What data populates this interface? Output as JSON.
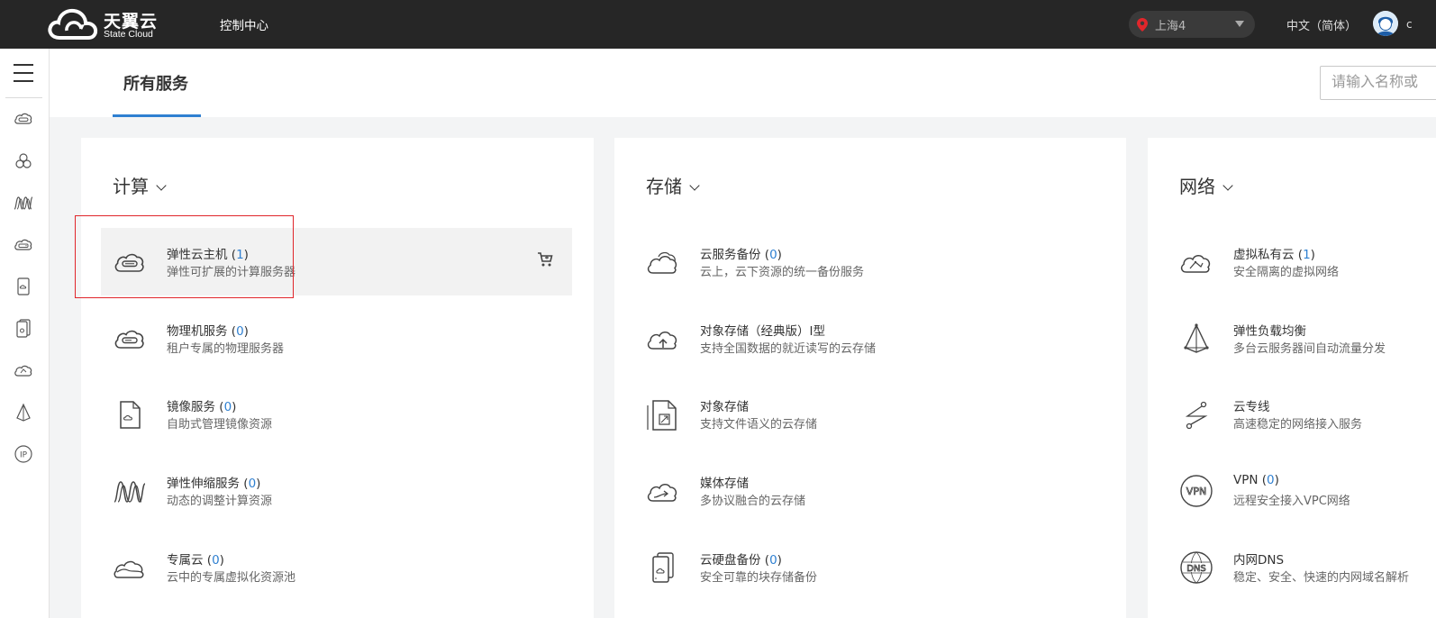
{
  "header": {
    "brand_cn": "天翼云",
    "brand_en": "State Cloud",
    "console_label": "控制中心",
    "region": "上海4",
    "language": "中文（简体）",
    "user_initial": "c"
  },
  "tabs": {
    "all_services": "所有服务"
  },
  "search": {
    "placeholder": "请输入名称或"
  },
  "sidebar": {
    "icons": [
      "ecs-icon",
      "cluster-icon",
      "autoscale-icon",
      "bms-icon",
      "image-icon",
      "backup-icon",
      "vpc-icon",
      "elb-icon",
      "eip-icon"
    ]
  },
  "categories": [
    {
      "title": "计算",
      "items": [
        {
          "name": "弹性云主机",
          "count": "1",
          "desc": "弹性可扩展的计算服务器",
          "icon": "ecs-icon"
        },
        {
          "name": "物理机服务",
          "count": "0",
          "desc": "租户专属的物理服务器",
          "icon": "bms-icon"
        },
        {
          "name": "镜像服务",
          "count": "0",
          "desc": "自助式管理镜像资源",
          "icon": "image-icon"
        },
        {
          "name": "弹性伸缩服务",
          "count": "0",
          "desc": "动态的调整计算资源",
          "icon": "autoscale-icon"
        },
        {
          "name": "专属云",
          "count": "0",
          "desc": "云中的专属虚拟化资源池",
          "icon": "dedicated-cloud-icon"
        }
      ]
    },
    {
      "title": "存储",
      "items": [
        {
          "name": "云服务备份",
          "count": "0",
          "desc": "云上，云下资源的统一备份服务",
          "icon": "cloud-backup-icon"
        },
        {
          "name": "对象存储（经典版）Ⅰ型",
          "count": "",
          "desc": "支持全国数据的就近读写的云存储",
          "icon": "cloud-upload-icon"
        },
        {
          "name": "对象存储",
          "count": "",
          "desc": "支持文件语义的云存储",
          "icon": "file-storage-icon"
        },
        {
          "name": "媒体存储",
          "count": "",
          "desc": "多协议融合的云存储",
          "icon": "media-storage-icon"
        },
        {
          "name": "云硬盘备份",
          "count": "0",
          "desc": "安全可靠的块存储备份",
          "icon": "disk-backup-icon"
        }
      ]
    },
    {
      "title": "网络",
      "items": [
        {
          "name": "虚拟私有云",
          "count": "1",
          "desc": "安全隔离的虚拟网络",
          "icon": "vpc-icon"
        },
        {
          "name": "弹性负载均衡",
          "count": "",
          "desc": "多台云服务器间自动流量分发",
          "icon": "elb-icon"
        },
        {
          "name": "云专线",
          "count": "",
          "desc": "高速稳定的网络接入服务",
          "icon": "direct-connect-icon"
        },
        {
          "name": "VPN",
          "count": "0",
          "desc": "远程安全接入VPC网络",
          "icon": "vpn-icon"
        },
        {
          "name": "内网DNS",
          "count": "",
          "desc": "稳定、安全、快速的内网域名解析",
          "icon": "dns-icon"
        }
      ]
    }
  ]
}
